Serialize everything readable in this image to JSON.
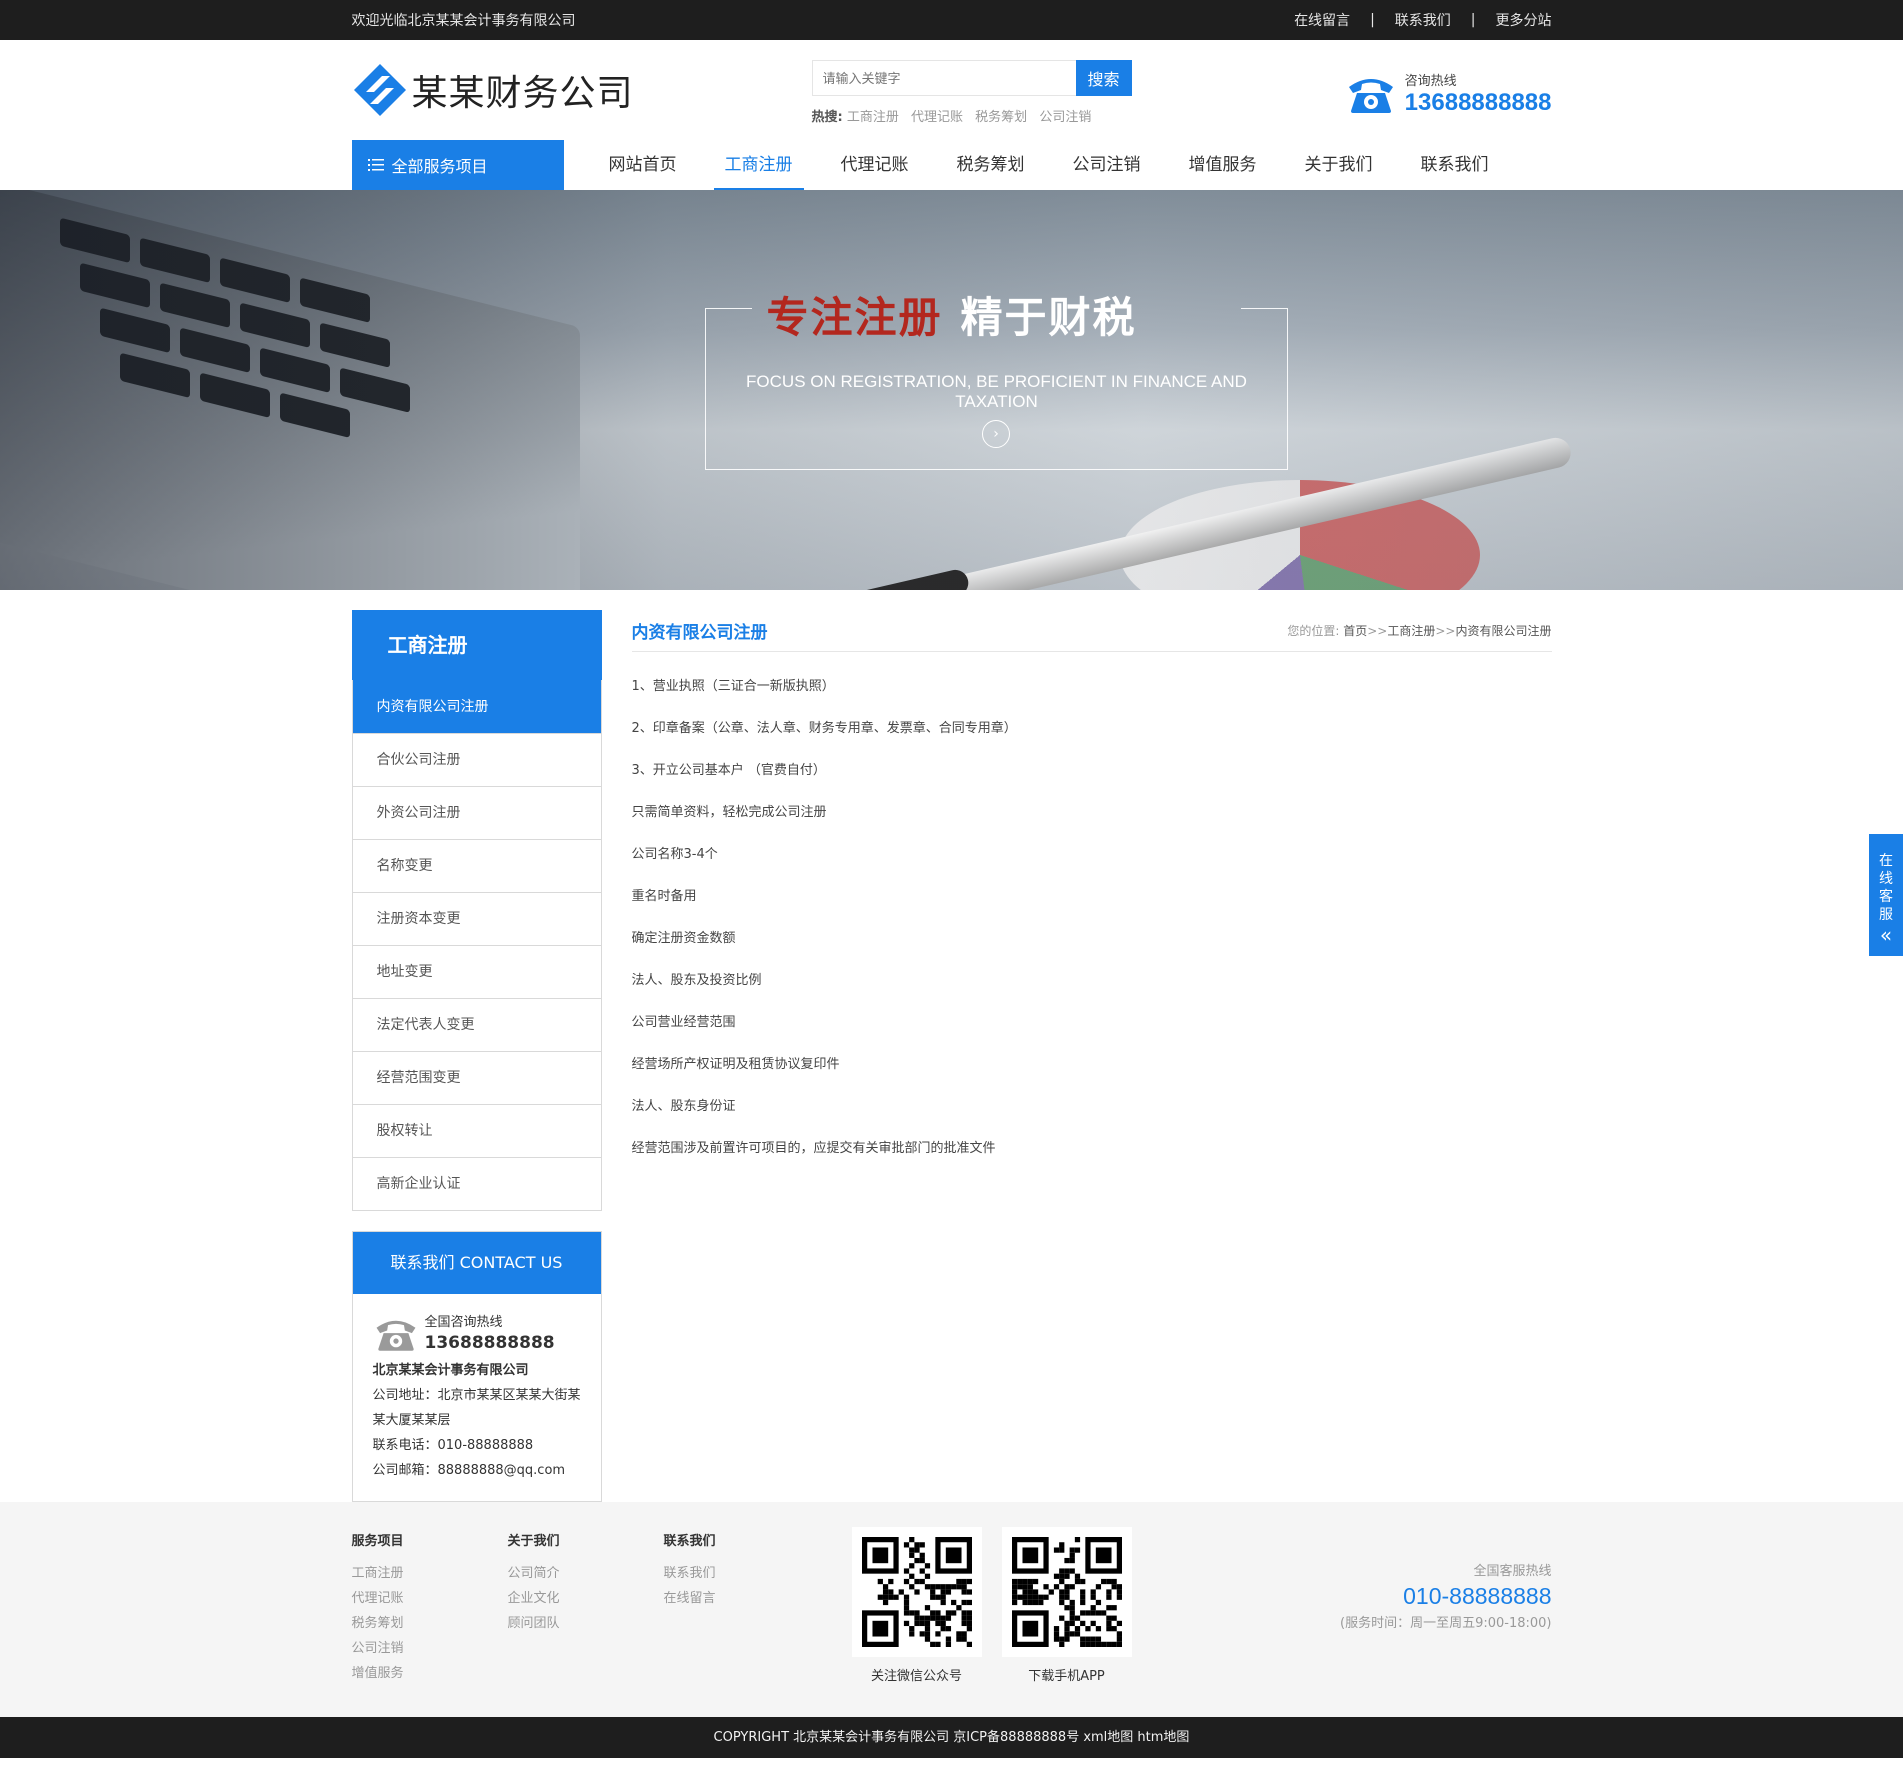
{
  "topbar": {
    "welcome": "欢迎光临北京某某会计事务有限公司",
    "links": [
      "在线留言",
      "联系我们",
      "更多分站"
    ],
    "sep": "|"
  },
  "header": {
    "logo_text": "某某财务公司",
    "search_placeholder": "请输入关键字",
    "search_button": "搜索",
    "hot_label": "热搜:",
    "hot_words": [
      "工商注册",
      "代理记账",
      "税务筹划",
      "公司注销"
    ],
    "hotline_label": "咨询热线",
    "hotline_number": "13688888888"
  },
  "nav": {
    "all_services": "全部服务项目",
    "items": [
      "网站首页",
      "工商注册",
      "代理记账",
      "税务筹划",
      "公司注销",
      "增值服务",
      "关于我们",
      "联系我们"
    ],
    "active_index": 1
  },
  "banner": {
    "slogan_red": "专注注册",
    "slogan_white": "精于财税",
    "slogan_en": "FOCUS ON REGISTRATION, BE PROFICIENT IN FINANCE AND TAXATION"
  },
  "sidebar": {
    "title": "工商注册",
    "items": [
      "内资有限公司注册",
      "合伙公司注册",
      "外资公司注册",
      "名称变更",
      "注册资本变更",
      "地址变更",
      "法定代表人变更",
      "经营范围变更",
      "股权转让",
      "高新企业认证"
    ],
    "active_index": 0,
    "contact": {
      "title": "联系我们 CONTACT US",
      "hotline_label": "全国咨询热线",
      "hotline_number": "13688888888",
      "company": "北京某某会计事务有限公司",
      "address": "公司地址：北京市某某区某某大街某某大厦某某层",
      "phone": "联系电话：010-88888888",
      "email": "公司邮箱：88888888@qq.com"
    }
  },
  "content": {
    "title": "内资有限公司注册",
    "crumb_prefix": "您的位置:",
    "crumb_home": "首页",
    "crumb_sep": ">>",
    "crumb_section": "工商注册",
    "crumb_current": "内资有限公司注册",
    "paragraphs": [
      "1、营业执照（三证合一新版执照）",
      "2、印章备案（公章、法人章、财务专用章、发票章、合同专用章）",
      "3、开立公司基本户 （官费自付）",
      "只需简单资料，轻松完成公司注册",
      "公司名称3-4个",
      "重名时备用",
      "确定注册资金数额",
      "法人、股东及投资比例",
      "公司营业经营范围",
      "经营场所产权证明及租赁协议复印件",
      "法人、股东身份证",
      "经营范围涉及前置许可项目的，应提交有关审批部门的批准文件"
    ]
  },
  "kefu": {
    "label": [
      "在",
      "线",
      "客",
      "服"
    ],
    "arrow": "«"
  },
  "footer": {
    "columns": [
      {
        "title": "服务项目",
        "links": [
          "工商注册",
          "代理记账",
          "税务筹划",
          "公司注销",
          "增值服务"
        ]
      },
      {
        "title": "关于我们",
        "links": [
          "公司简介",
          "企业文化",
          "顾问团队"
        ]
      },
      {
        "title": "联系我们",
        "links": [
          "联系我们",
          "在线留言"
        ]
      }
    ],
    "qrcodes": [
      "关注微信公众号",
      "下载手机APP"
    ],
    "service_label": "全国客服热线",
    "service_number": "010-88888888",
    "service_hours": "(服务时间：周一至周五9:00-18:00)",
    "copyright": "COPYRIGHT 北京某某会计事务有限公司 京ICP备88888888号 xml地图 htm地图"
  },
  "colors": {
    "accent": "#1a7fe6",
    "dark": "#1e1e1e",
    "banner_red": "#b3271e"
  }
}
